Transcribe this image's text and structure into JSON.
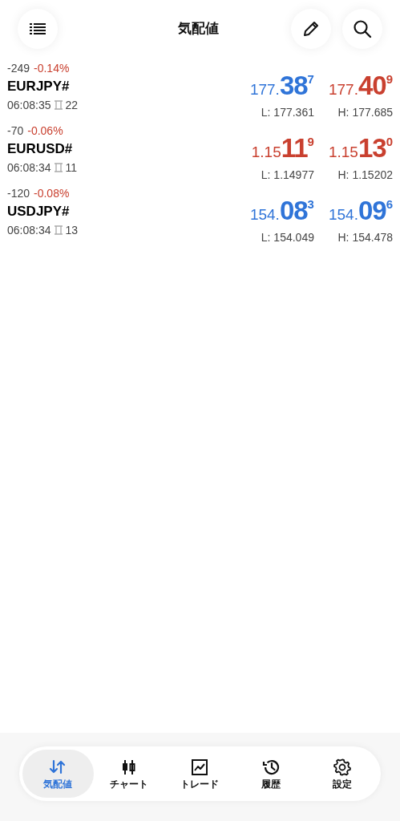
{
  "header": {
    "title": "気配値"
  },
  "quotes": [
    {
      "points": "-249",
      "percent": "-0.14%",
      "symbol": "EURJPY#",
      "time": "06:08:35",
      "spread": "22",
      "bid": {
        "prefix": "177.",
        "big": "38",
        "sup": "7",
        "color": "#2f74d8"
      },
      "ask": {
        "prefix": "177.",
        "big": "40",
        "sup": "9",
        "color": "#c9402f"
      },
      "low": "L: 177.361",
      "high": "H: 177.685"
    },
    {
      "points": "-70",
      "percent": "-0.06%",
      "symbol": "EURUSD#",
      "time": "06:08:34",
      "spread": "11",
      "bid": {
        "prefix": "1.15",
        "big": "11",
        "sup": "9",
        "color": "#c9402f"
      },
      "ask": {
        "prefix": "1.15",
        "big": "13",
        "sup": "0",
        "color": "#c9402f"
      },
      "low": "L: 1.14977",
      "high": "H: 1.15202"
    },
    {
      "points": "-120",
      "percent": "-0.08%",
      "symbol": "USDJPY#",
      "time": "06:08:34",
      "spread": "13",
      "bid": {
        "prefix": "154.",
        "big": "08",
        "sup": "3",
        "color": "#2f74d8"
      },
      "ask": {
        "prefix": "154.",
        "big": "09",
        "sup": "6",
        "color": "#2f74d8"
      },
      "low": "L: 154.049",
      "high": "H: 154.478"
    }
  ],
  "nav": [
    {
      "kind": "quotes",
      "label": "気配値",
      "selected": true
    },
    {
      "kind": "chart",
      "label": "チャート",
      "selected": false
    },
    {
      "kind": "trade",
      "label": "トレード",
      "selected": false
    },
    {
      "kind": "history",
      "label": "履歴",
      "selected": false
    },
    {
      "kind": "settings",
      "label": "設定",
      "selected": false
    }
  ]
}
